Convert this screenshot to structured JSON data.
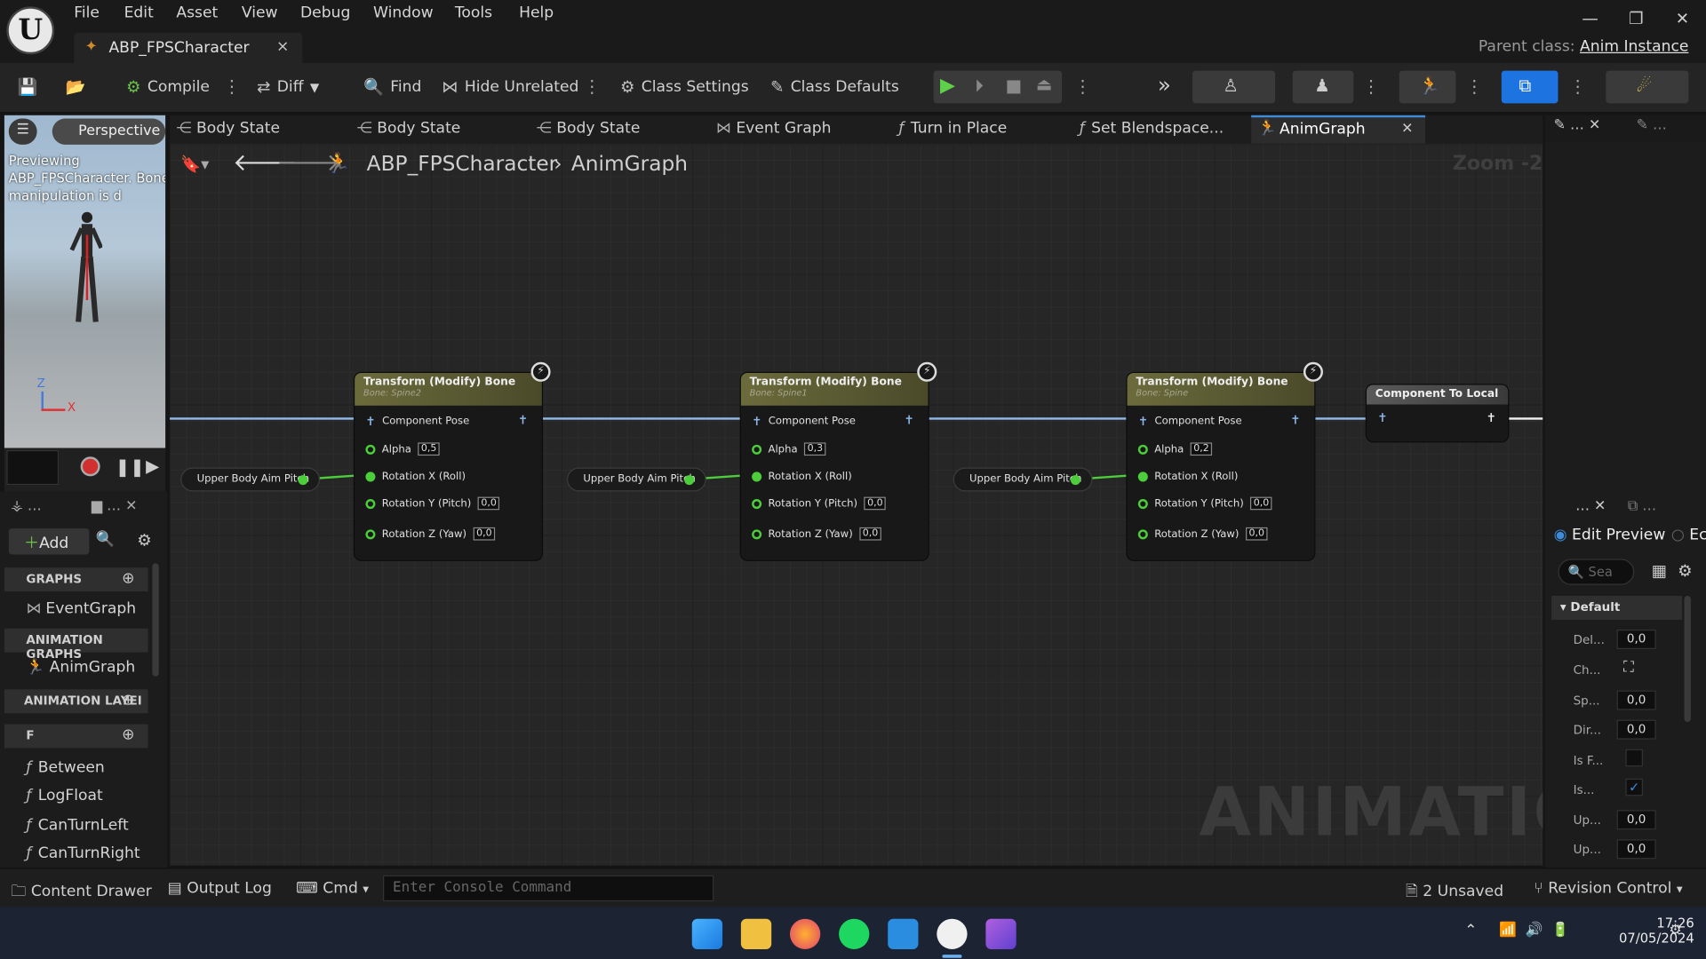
{
  "menu": [
    "File",
    "Edit",
    "Asset",
    "View",
    "Debug",
    "Window",
    "Tools",
    "Help"
  ],
  "tab": {
    "title": "ABP_FPSCharacter",
    "close": "×"
  },
  "window": {
    "minimize": "—",
    "restore": "❐",
    "close": "✕"
  },
  "parent_class": {
    "label": "Parent class:",
    "value": "Anim Instance"
  },
  "toolbar": {
    "compile": "Compile",
    "diff": "Diff",
    "find": "Find",
    "hide_unrelated": "Hide Unrelated",
    "class_settings": "Class Settings",
    "class_defaults": "Class Defaults"
  },
  "viewport": {
    "mode": "Perspective",
    "message": "Previewing ABP_FPSCharacter. Bone manipulation is d",
    "axis_z": "Z",
    "axis_x": "X"
  },
  "mybp": {
    "add": "Add",
    "graphs_label": "GRAPHS",
    "graphs": [
      "EventGraph"
    ],
    "anim_graphs_label": "ANIMATION GRAPHS",
    "anim_graphs": [
      "AnimGraph"
    ],
    "anim_layers_label": "ANIMATION LAYEI",
    "functions_label": "F",
    "functions": [
      "Between",
      "LogFloat",
      "CanTurnLeft",
      "CanTurnRight"
    ]
  },
  "doc_tabs": [
    "Body State",
    "Body State",
    "Body State",
    "Event Graph",
    "Turn in Place",
    "Set Blendspace...",
    "AnimGraph"
  ],
  "breadcrumb": {
    "asset": "ABP_FPSCharacter",
    "graph": "AnimGraph",
    "separator": "›"
  },
  "zoom": "Zoom -2",
  "watermark": "ANIMATION",
  "nodes": [
    {
      "title": "Transform (Modify) Bone",
      "bone": "Bone: Spine2",
      "pose": "Component Pose",
      "alpha": "0,5",
      "rx": "Rotation X (Roll)",
      "ry": "Rotation Y (Pitch)",
      "ry_val": "0,0",
      "rz": "Rotation Z (Yaw)",
      "rz_val": "0,0"
    },
    {
      "title": "Transform (Modify) Bone",
      "bone": "Bone: Spine1",
      "pose": "Component Pose",
      "alpha": "0,3",
      "rx": "Rotation X (Roll)",
      "ry": "Rotation Y (Pitch)",
      "ry_val": "0,0",
      "rz": "Rotation Z (Yaw)",
      "rz_val": "0,0"
    },
    {
      "title": "Transform (Modify) Bone",
      "bone": "Bone: Spine",
      "pose": "Component Pose",
      "alpha": "0,2",
      "rx": "Rotation X (Roll)",
      "ry": "Rotation Y (Pitch)",
      "ry_val": "0,0",
      "rz": "Rotation Z (Yaw)",
      "rz_val": "0,0"
    }
  ],
  "alpha_label": "Alpha",
  "getter": "Upper Body Aim Pitch",
  "component_to_local": "Component To Local",
  "details": {
    "edit_preview": "Edit Preview",
    "edit_other": "Ec",
    "search_placeholder": "Sea",
    "category": "Default",
    "rows": [
      {
        "label": "Del...",
        "value": "0,0"
      },
      {
        "label": "Ch...",
        "value": ""
      },
      {
        "label": "Sp...",
        "value": "0,0"
      },
      {
        "label": "Dir...",
        "value": "0,0"
      },
      {
        "label": "Is F...",
        "value": ""
      },
      {
        "label": "Is...",
        "value": ""
      },
      {
        "label": "Up...",
        "value": "0,0"
      },
      {
        "label": "Up...",
        "value": "0,0"
      }
    ]
  },
  "statusbar": {
    "content_drawer": "Content Drawer",
    "output_log": "Output Log",
    "cmd": "Cmd",
    "console_placeholder": "Enter Console Command",
    "unsaved": "2 Unsaved",
    "revision_control": "Revision Control"
  },
  "clock": {
    "time": "17:26",
    "date": "07/05/2024"
  },
  "colors": {
    "accent": "#3d8bd9",
    "exec_green": "#4ccd3a",
    "pose_wire": "#8fb9e8",
    "node_header": "#6b6b3c"
  }
}
